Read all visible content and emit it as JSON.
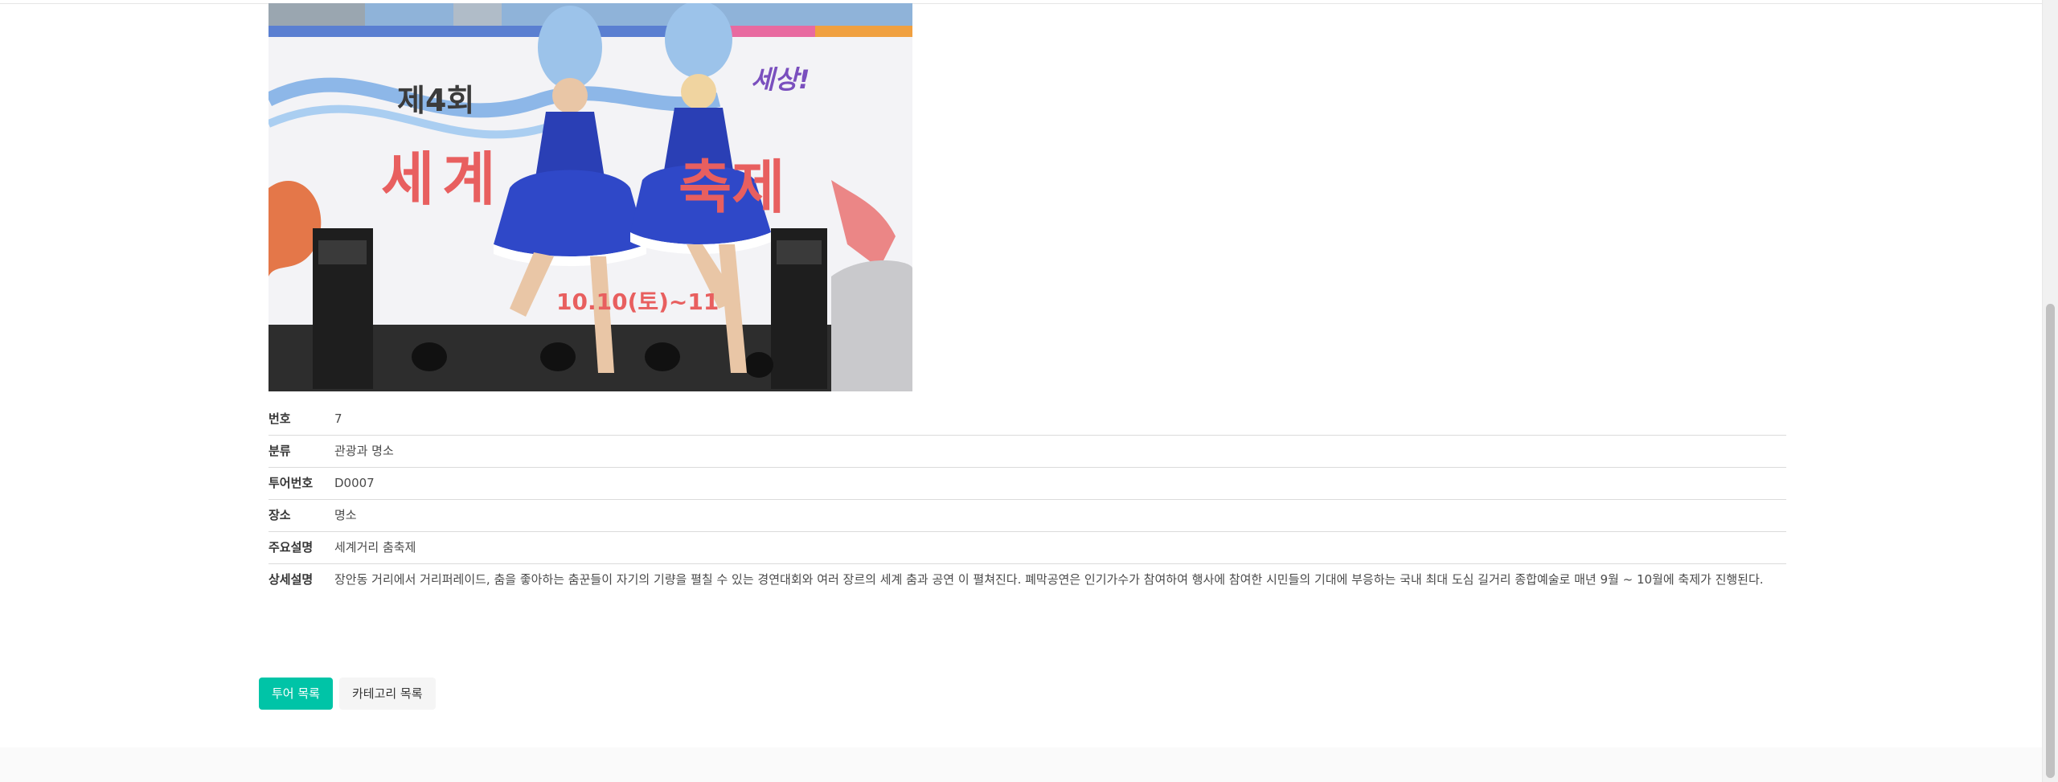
{
  "photo": {
    "alt": "세계거리 춤축제",
    "banner_number": "제4회",
    "banner_title_left": "세계",
    "banner_title_right": "축제",
    "banner_slogan": "세상!",
    "banner_date": "10.10(토)~11"
  },
  "details": [
    {
      "label": "번호",
      "value": "7"
    },
    {
      "label": "분류",
      "value": "관광과 명소"
    },
    {
      "label": "투어번호",
      "value": "D0007"
    },
    {
      "label": "장소",
      "value": "명소"
    },
    {
      "label": "주요설명",
      "value": "세계거리 춤축제"
    },
    {
      "label": "상세설명",
      "value": "장안동 거리에서 거리퍼레이드, 춤을 좋아하는 춤꾼들이 자기의 기량을 펼칠 수 있는 경연대회와 여러 장르의 세계 춤과 공연 이 펼쳐진다. 폐막공연은 인기가수가 참여하여 행사에 참여한 시민들의 기대에 부응하는 국내 최대 도심 길거리 종합예술로 매년 9월 ~ 10월에 축제가 진행된다."
    }
  ],
  "buttons": {
    "tour_list": "투어 목록",
    "category_list": "카테고리 목록"
  },
  "colors": {
    "primary": "#00c4a7",
    "light": "#f5f5f5",
    "dress": "#2a3fb5"
  }
}
